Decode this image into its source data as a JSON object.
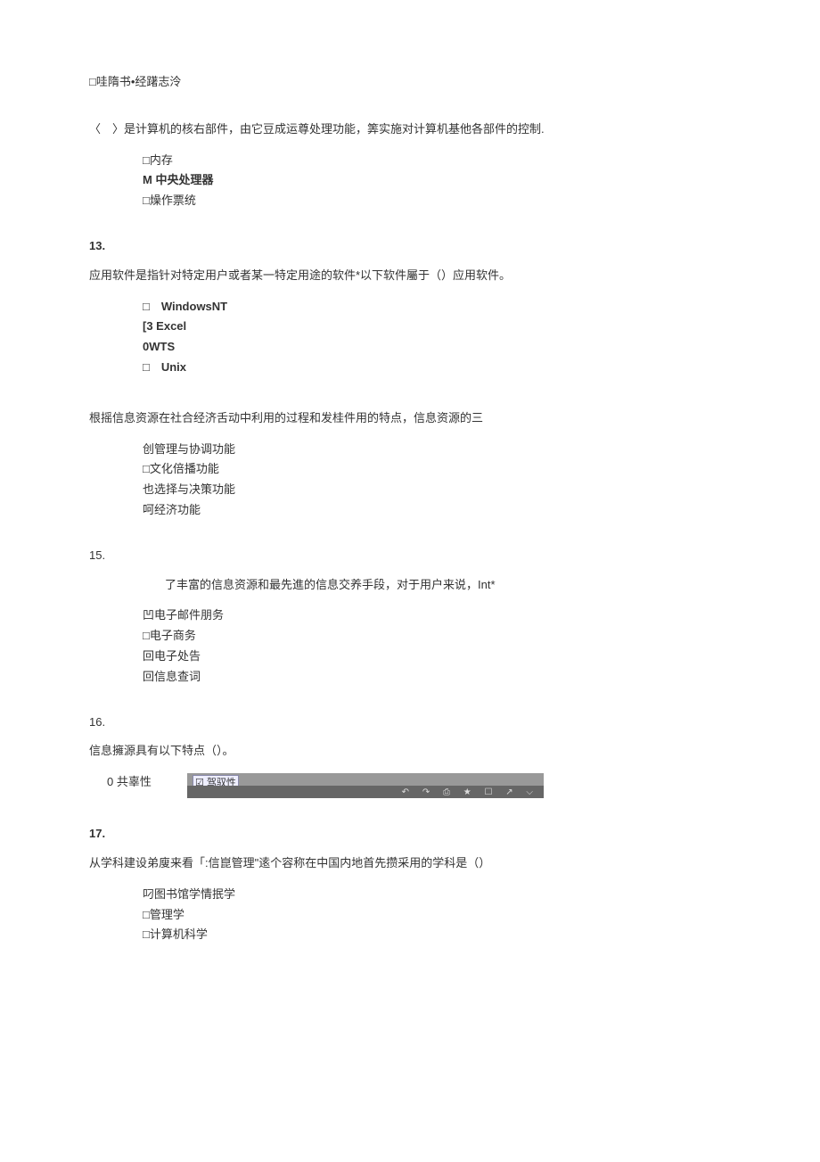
{
  "pre_option": "□哇隋书•经躇志泠",
  "q12": {
    "text": "〈　〉是计算机的核右部件，由它豆成运尊处理功能，筭实施对计算机基他各部件的控制.",
    "opts": [
      "□内存",
      "M 中央处理器",
      "□燥作票统"
    ]
  },
  "q13": {
    "num": "13.",
    "text": "应用软件是指针对特定用户或者某一特定用途的软件*以下软件屬于（）应用软件。",
    "opts": [
      "□　WindowsNT",
      "[3 Excel",
      "0WTS",
      "□　Unix"
    ]
  },
  "q14": {
    "text": "根摇信息资源在社合经济舌动中利用的过程和发桂件用的特点，信息资源的三",
    "opts": [
      "创管理与协调功能",
      "□文化倍播功能",
      "也选择与决策功能",
      "呵经济功能"
    ]
  },
  "q15": {
    "num": "15.",
    "text": "了丰富的信息资源和最先進的信息交养手段，对于用户来说，Int*",
    "opts": [
      "凹电子邮件朋务",
      "□电子商务",
      "回电子处告",
      "回信息查词"
    ]
  },
  "q16": {
    "num": "16.",
    "text": "信息擁源具有以下特点（）。",
    "opt1": "0 共辜性",
    "bar_text": "☑ 驾驭性"
  },
  "q17": {
    "num": "17.",
    "text": "从学科建设弟廋来看「:信崑管理\"逺个容称在中国内地首先攒采用的学科是（）",
    "opts": [
      "叼图书馆学情抿学",
      "□管理学",
      "□计算机科学"
    ]
  }
}
